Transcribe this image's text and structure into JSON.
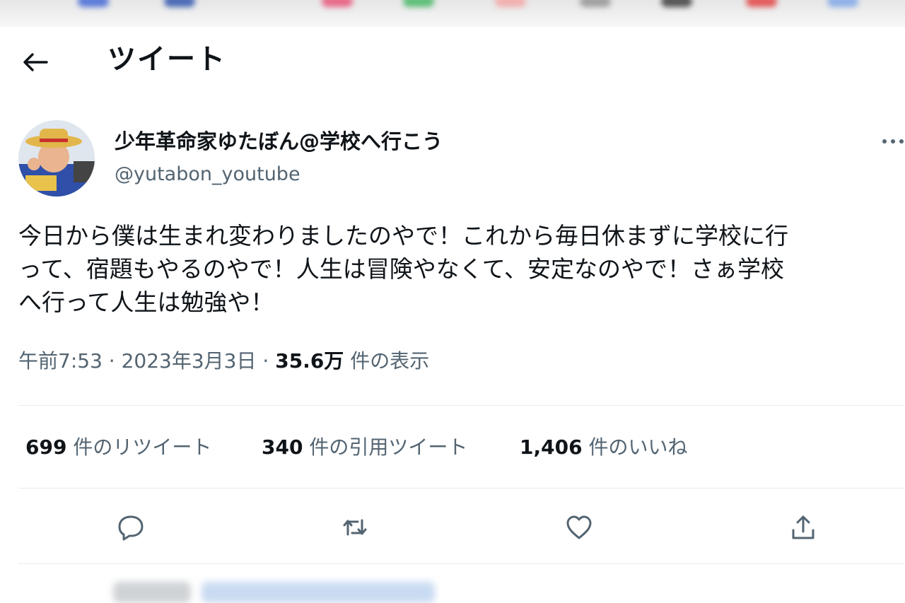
{
  "header": {
    "title": "ツイート",
    "back_icon": "arrow-left-icon"
  },
  "author": {
    "display_name": "少年革命家ゆたぼん@学校へ行こう",
    "handle": "@yutabon_youtube"
  },
  "tweet": {
    "lines": [
      "今日から僕は生まれ変わりましたのやで！これから毎日休まずに学校に行",
      "って、宿題もやるのやで！人生は冒険やなくて、安定なのやで！さぁ学校",
      "へ行って人生は勉強や！"
    ]
  },
  "meta": {
    "time": "午前7:53",
    "separator": "·",
    "date": "2023年3月3日",
    "views_count": "35.6万",
    "views_label": "件の表示"
  },
  "stats": {
    "retweets": {
      "count": "699",
      "label": "件のリツイート"
    },
    "quotes": {
      "count": "340",
      "label": "件の引用ツイート"
    },
    "likes": {
      "count": "1,406",
      "label": "件のいいね"
    }
  },
  "actions": [
    "reply-icon",
    "retweet-icon",
    "like-icon",
    "share-icon"
  ],
  "colors": {
    "text": "#0f1419",
    "secondary": "#536471",
    "divider": "#e6ecf0"
  }
}
